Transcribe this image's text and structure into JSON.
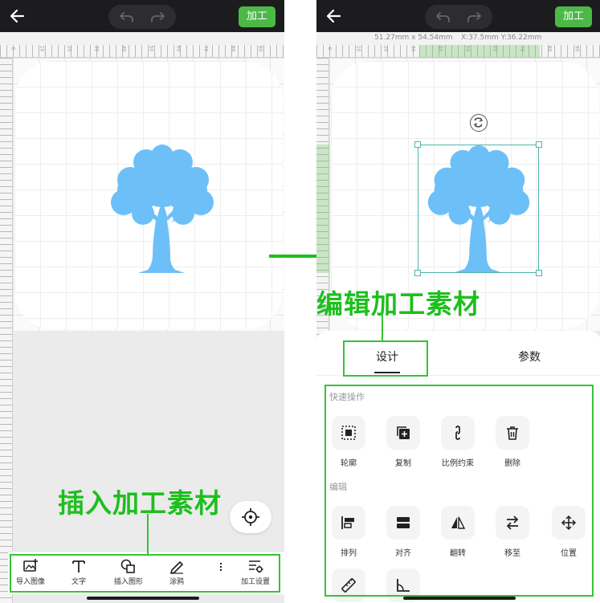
{
  "left_screen": {
    "process_label": "加工",
    "callout": "插入加工素材",
    "toolbar": {
      "items": [
        {
          "label": "导入图像",
          "icon": "image-add-icon"
        },
        {
          "label": "文字",
          "icon": "text-icon"
        },
        {
          "label": "插入图形",
          "icon": "shapes-icon"
        },
        {
          "label": "涂鸦",
          "icon": "pencil-icon"
        },
        {
          "label": "加工设置",
          "icon": "settings-sliders-icon"
        }
      ]
    }
  },
  "right_screen": {
    "process_label": "加工",
    "dimension_text": "51.27mm x 54.54mm",
    "position_text": "X:37.5mm Y:36.22mm",
    "callout": "编辑加工素材",
    "tabs": [
      {
        "label": "设计",
        "active": true
      },
      {
        "label": "参数",
        "active": false
      }
    ],
    "sections": {
      "quick_title": "快速操作",
      "edit_title": "编辑"
    },
    "quick_actions": [
      {
        "label": "轮廓",
        "icon": "outline-icon"
      },
      {
        "label": "复制",
        "icon": "copy-icon"
      },
      {
        "label": "比例约束",
        "icon": "link-icon"
      },
      {
        "label": "删除",
        "icon": "trash-icon"
      }
    ],
    "edit_actions": [
      {
        "label": "排列",
        "icon": "arrange-icon"
      },
      {
        "label": "对齐",
        "icon": "align-icon"
      },
      {
        "label": "翻转",
        "icon": "flip-icon"
      },
      {
        "label": "移至",
        "icon": "move-to-icon"
      },
      {
        "label": "位置",
        "icon": "position-icon"
      }
    ]
  },
  "ruler_labels": [
    "0",
    "10",
    "20",
    "30",
    "40",
    "50",
    "60",
    "70",
    "80",
    "90",
    "100"
  ],
  "colors": {
    "accent_green": "#4cb848",
    "callout_green": "#1dbf1d",
    "tree_blue": "#6cc0f7",
    "top_bar": "#1c1c1e"
  }
}
